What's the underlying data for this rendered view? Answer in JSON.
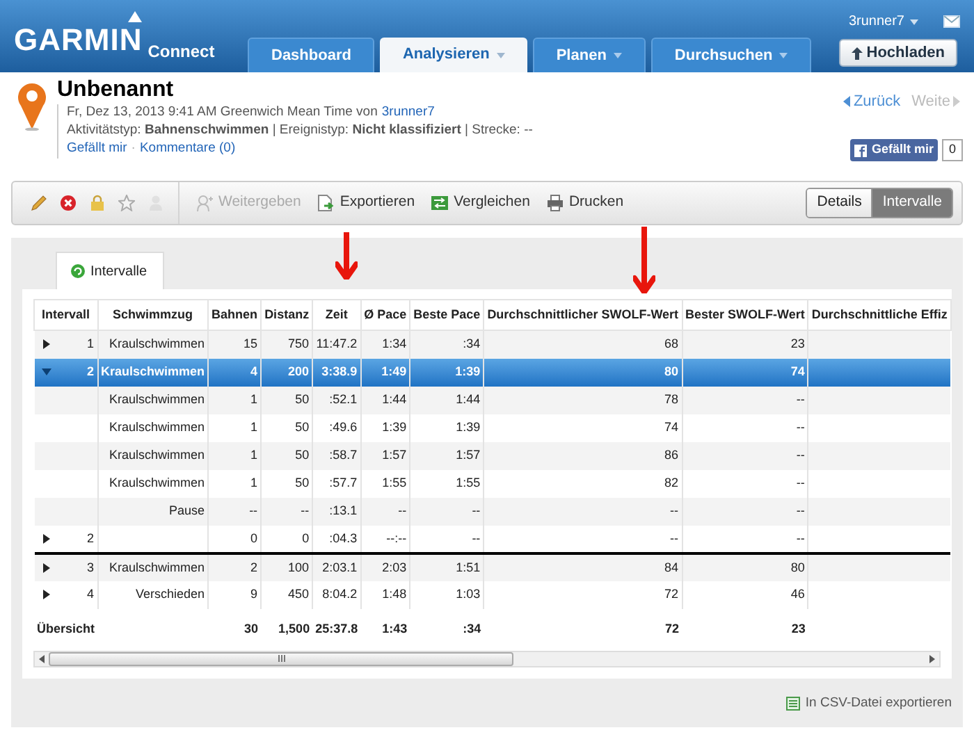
{
  "header": {
    "logo": "GARMIN",
    "logo_suffix": "Connect",
    "user": "3runner7",
    "upload_button": "Hochladen",
    "tabs": [
      {
        "label": "Dashboard",
        "selected": false,
        "dropdown": false
      },
      {
        "label": "Analysieren",
        "selected": true,
        "dropdown": true
      },
      {
        "label": "Planen",
        "selected": false,
        "dropdown": true
      },
      {
        "label": "Durchsuchen",
        "selected": false,
        "dropdown": true
      }
    ]
  },
  "activity": {
    "title": "Unbenannt",
    "meta": "Fr, Dez 13, 2013 9:41 AM Greenwich Mean Time von",
    "author": "3runner7",
    "details": "Aktivitätstyp: **Bahnenschwimmen** | Ereignistyp: **Nicht klassifiziert** | Strecke: --",
    "links": [
      "Gefällt mir",
      "Kommentare (0)"
    ],
    "link_separator": "·",
    "nav": [
      {
        "label": "Zurück",
        "disabled": false
      },
      {
        "label": "Weite",
        "disabled": true
      }
    ],
    "like_button": "Gefällt mir",
    "like_count": "0"
  },
  "toolbar": {
    "icon_buttons": [
      {
        "kind": "edit",
        "disabled": false
      },
      {
        "kind": "delete",
        "disabled": false
      },
      {
        "kind": "lock",
        "disabled": false
      },
      {
        "kind": "star",
        "disabled": false
      },
      {
        "kind": "person",
        "disabled": true
      }
    ],
    "actions": [
      {
        "kind": "share",
        "label": "Weitergeben",
        "disabled": true
      },
      {
        "kind": "export",
        "label": "Exportieren",
        "disabled": false
      },
      {
        "kind": "compare",
        "label": "Vergleichen",
        "disabled": false
      },
      {
        "kind": "print",
        "label": "Drucken",
        "disabled": false
      }
    ],
    "views": [
      {
        "label": "Details",
        "selected": false
      },
      {
        "label": "Intervalle",
        "selected": true
      }
    ]
  },
  "panel": {
    "tab": "Intervalle",
    "table": {
      "columns": [
        "Intervall",
        "Schwimmzug",
        "Bahnen",
        "Distanz",
        "Zeit",
        "Ø Pace",
        "Beste Pace",
        "Durchschnittlicher SWOLF-Wert",
        "Bester SWOLF-Wert",
        "Durchschnittliche Effiz"
      ],
      "rows": [
        {
          "kind": "interval",
          "expanded": false,
          "selected": false,
          "divider_above": false,
          "cells": [
            "1",
            "Kraulschwimmen",
            "15",
            "750",
            "11:47.2",
            "1:34",
            ":34",
            "68",
            "23"
          ]
        },
        {
          "kind": "interval",
          "expanded": true,
          "selected": true,
          "divider_above": false,
          "cells": [
            "2",
            "Kraulschwimmen",
            "4",
            "200",
            "3:38.9",
            "1:49",
            "1:39",
            "80",
            "74"
          ]
        },
        {
          "kind": "length",
          "selected": false,
          "divider_above": false,
          "cells": [
            "",
            "Kraulschwimmen",
            "1",
            "50",
            ":52.1",
            "1:44",
            "1:44",
            "78",
            "--"
          ]
        },
        {
          "kind": "length",
          "selected": false,
          "divider_above": false,
          "cells": [
            "",
            "Kraulschwimmen",
            "1",
            "50",
            ":49.6",
            "1:39",
            "1:39",
            "74",
            "--"
          ]
        },
        {
          "kind": "length",
          "selected": false,
          "divider_above": false,
          "cells": [
            "",
            "Kraulschwimmen",
            "1",
            "50",
            ":58.7",
            "1:57",
            "1:57",
            "86",
            "--"
          ]
        },
        {
          "kind": "length",
          "selected": false,
          "divider_above": false,
          "cells": [
            "",
            "Kraulschwimmen",
            "1",
            "50",
            ":57.7",
            "1:55",
            "1:55",
            "82",
            "--"
          ]
        },
        {
          "kind": "length",
          "selected": false,
          "divider_above": false,
          "cells": [
            "",
            "Pause",
            "--",
            "--",
            ":13.1",
            "--",
            "--",
            "--",
            "--"
          ]
        },
        {
          "kind": "interval",
          "expanded": false,
          "selected": false,
          "divider_above": false,
          "cells": [
            "2",
            "",
            "0",
            "0",
            ":04.3",
            "--:--",
            "--",
            "--",
            "--"
          ]
        },
        {
          "kind": "interval",
          "expanded": false,
          "selected": false,
          "divider_above": true,
          "cells": [
            "3",
            "Kraulschwimmen",
            "2",
            "100",
            "2:03.1",
            "2:03",
            "1:51",
            "84",
            "80"
          ]
        },
        {
          "kind": "interval",
          "expanded": false,
          "selected": false,
          "divider_above": false,
          "cells": [
            "4",
            "Verschieden",
            "9",
            "450",
            "8:04.2",
            "1:48",
            "1:03",
            "72",
            "46"
          ]
        }
      ],
      "summary": {
        "cells": [
          "Übersicht",
          "",
          "30",
          "1,500",
          "25:37.8",
          "1:43",
          ":34",
          "72",
          "23"
        ]
      }
    },
    "csv_link": "In CSV-Datei exportieren"
  }
}
